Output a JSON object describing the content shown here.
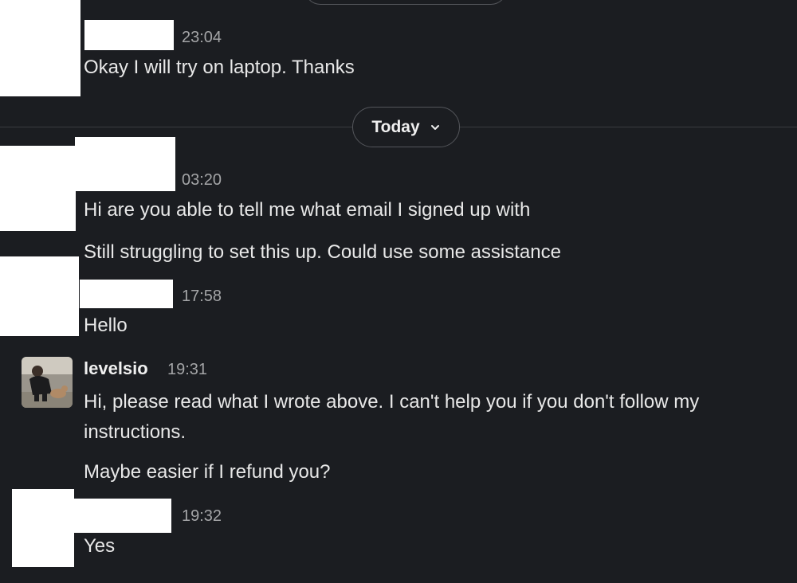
{
  "day_divider": {
    "label": "Today"
  },
  "messages": [
    {
      "time": "23:04",
      "text": "Okay I will try on laptop. Thanks"
    },
    {
      "time": "03:20",
      "lines": [
        "Hi are you able to tell me what email I signed up with",
        "Still struggling to set this up. Could use some assistance"
      ]
    },
    {
      "time": "17:58",
      "text": "Hello"
    },
    {
      "author": "levelsio",
      "time": "19:31",
      "lines": [
        "Hi, please read what I wrote above. I can't help you if you don't follow my instructions.",
        "Maybe easier if I refund you?"
      ]
    },
    {
      "time": "19:32",
      "text": "Yes"
    }
  ],
  "icons": {
    "chevron": "chevron-down-icon"
  }
}
